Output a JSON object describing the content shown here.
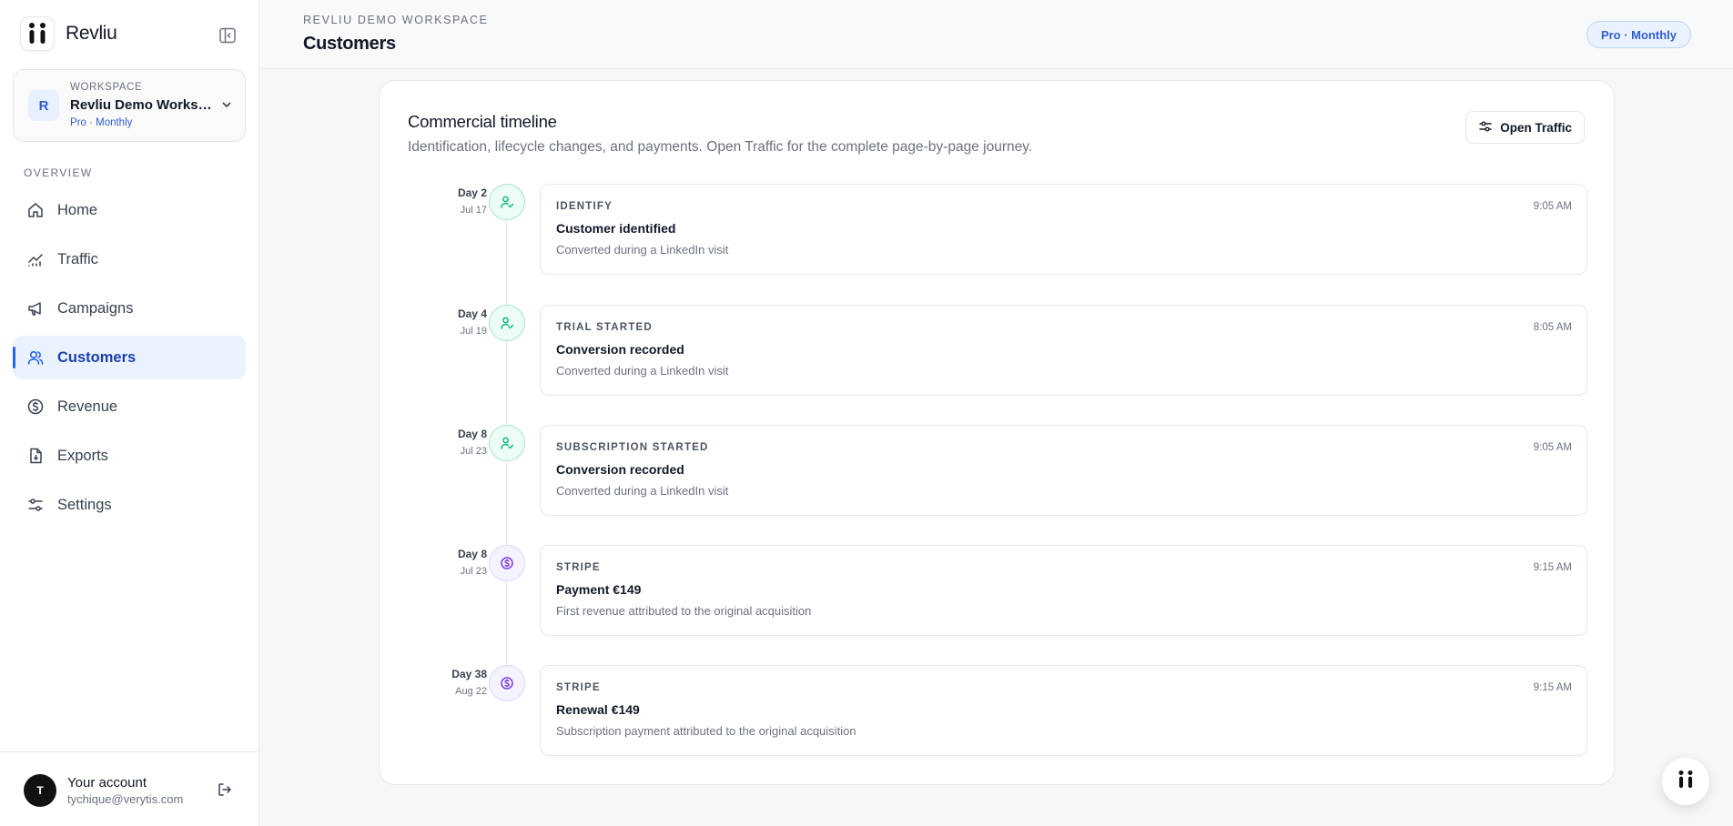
{
  "brand": {
    "name": "Revliu",
    "logo_icon": "revliu-logo-icon"
  },
  "workspace": {
    "label": "WORKSPACE",
    "name": "Revliu Demo Workspace",
    "plan": "Pro · Monthly",
    "avatar_letter": "R"
  },
  "sidebar": {
    "section_title": "OVERVIEW",
    "items": [
      {
        "label": "Home",
        "icon": "home-icon",
        "active": false
      },
      {
        "label": "Traffic",
        "icon": "chart-line-icon",
        "active": false
      },
      {
        "label": "Campaigns",
        "icon": "megaphone-icon",
        "active": false
      },
      {
        "label": "Customers",
        "icon": "users-icon",
        "active": true
      },
      {
        "label": "Revenue",
        "icon": "dollar-circle-icon",
        "active": false
      },
      {
        "label": "Exports",
        "icon": "file-export-icon",
        "active": false
      },
      {
        "label": "Settings",
        "icon": "sliders-icon",
        "active": false
      }
    ]
  },
  "account": {
    "avatar_letter": "T",
    "name": "Your account",
    "email": "tychique@verytis.com"
  },
  "header": {
    "eyebrow": "REVLIU DEMO WORKSPACE",
    "title": "Customers",
    "plan_badge": "Pro · Monthly"
  },
  "timeline": {
    "title": "Commercial timeline",
    "subtitle": "Identification, lifecycle changes, and payments. Open Traffic for the complete page-by-page journey.",
    "open_traffic_label": "Open Traffic",
    "events": [
      {
        "day": "Day 2",
        "date": "Jul 17",
        "type": "IDENTIFY",
        "time": "9:05 AM",
        "title": "Customer identified",
        "description": "Converted during a LinkedIn visit",
        "kind": "user"
      },
      {
        "day": "Day 4",
        "date": "Jul 19",
        "type": "TRIAL STARTED",
        "time": "8:05 AM",
        "title": "Conversion recorded",
        "description": "Converted during a LinkedIn visit",
        "kind": "user"
      },
      {
        "day": "Day 8",
        "date": "Jul 23",
        "type": "SUBSCRIPTION STARTED",
        "time": "9:05 AM",
        "title": "Conversion recorded",
        "description": "Converted during a LinkedIn visit",
        "kind": "user"
      },
      {
        "day": "Day 8",
        "date": "Jul 23",
        "type": "STRIPE",
        "time": "9:15 AM",
        "title": "Payment €149",
        "description": "First revenue attributed to the original acquisition",
        "kind": "payment"
      },
      {
        "day": "Day 38",
        "date": "Aug 22",
        "type": "STRIPE",
        "time": "9:15 AM",
        "title": "Renewal €149",
        "description": "Subscription payment attributed to the original acquisition",
        "kind": "payment"
      }
    ]
  },
  "colors": {
    "accent": "#2563eb",
    "active_bg": "#eaf2fd",
    "success": "#10b981",
    "payment": "#7c3aed"
  }
}
